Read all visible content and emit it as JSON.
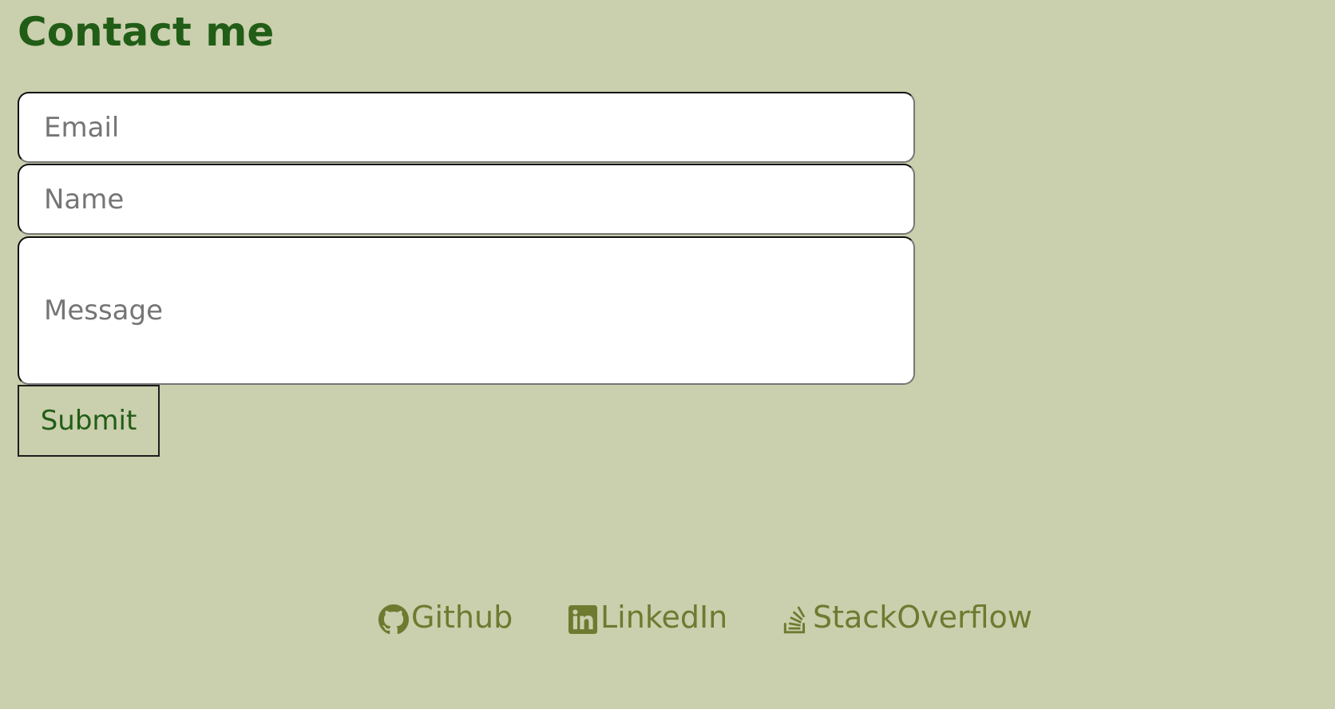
{
  "page": {
    "title": "Contact me"
  },
  "form": {
    "email_placeholder": "Email",
    "name_placeholder": "Name",
    "message_placeholder": "Message",
    "submit_label": "Submit"
  },
  "footer": {
    "links": [
      {
        "label": "Github",
        "icon": "github-icon"
      },
      {
        "label": "LinkedIn",
        "icon": "linkedin-icon"
      },
      {
        "label": "StackOverflow",
        "icon": "stackoverflow-icon"
      }
    ]
  },
  "colors": {
    "background": "#cacfad",
    "heading": "#215d16",
    "link": "#6e7a30",
    "input_background": "#ffffff",
    "placeholder": "#757575"
  }
}
